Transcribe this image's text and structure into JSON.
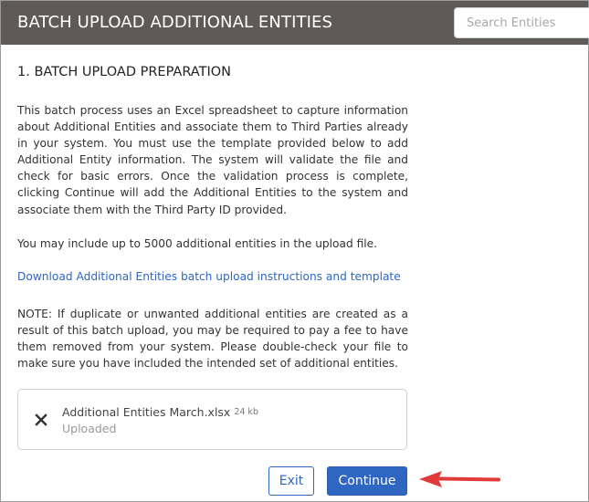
{
  "header": {
    "title": "BATCH UPLOAD ADDITIONAL ENTITIES",
    "search_placeholder": "Search Entities"
  },
  "section": {
    "title": "1. BATCH UPLOAD PREPARATION",
    "intro": "This batch process uses an Excel spreadsheet to capture information about Additional Entities and associate them to Third Parties already in your system. You must use the template provided below to add Additional Entity information. The system will validate the file and check for basic errors. Once the validation process is complete, clicking Continue will add the Additional Entities to the system and associate them with the Third Party ID provided.",
    "limit": "You may include up to 5000 additional entities in the upload file.",
    "download_link": "Download Additional Entities batch upload instructions and template",
    "note": "NOTE: If duplicate or unwanted additional entities are created as a result of this batch upload, you may be required to pay a fee to have them removed from your system. Please double-check your file to make sure you have included the intended set of additional entities."
  },
  "file": {
    "name": "Additional Entities March.xlsx",
    "size": "24 kb",
    "status": "Uploaded",
    "remove_icon": "close-icon"
  },
  "buttons": {
    "exit": "Exit",
    "continue": "Continue"
  },
  "colors": {
    "header_bg": "#5f5a57",
    "accent": "#2f66c2",
    "annotation_arrow": "#e03a3a"
  }
}
